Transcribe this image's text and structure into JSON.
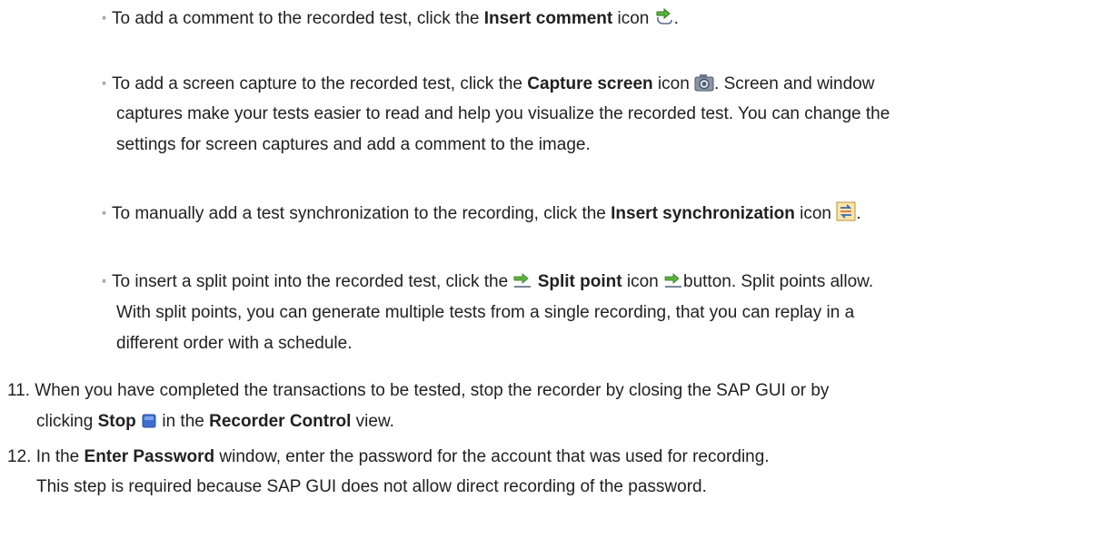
{
  "bullets": {
    "marker": "◦",
    "b1": {
      "pre": "To add a comment to the recorded test, click the ",
      "bold": "Insert comment",
      "post": " icon",
      "end": ".",
      "icon": "insert-comment-icon"
    },
    "b2": {
      "pre": "To add a screen capture to the recorded test, click the ",
      "bold": "Capture screen",
      "post": " icon",
      "after_icon": ". Screen and window",
      "line2": "captures make your tests easier to read and help you visualize the recorded test. You can change the",
      "line3": "settings for screen captures and add a comment to the image.",
      "icon": "camera-icon"
    },
    "b3": {
      "pre": "To manually add a test synchronization to the recording, click the ",
      "bold": "Insert synchronization",
      "post": " icon",
      "end": ".",
      "icon": "synchronization-icon"
    },
    "b4": {
      "pre": "To insert a split point into the recorded test, click the",
      "bold": "Split point",
      "post": " icon",
      "after_icon": "button. Split points allow.",
      "line2": "With split points, you can generate multiple tests from a single recording, that you can replay in a",
      "line3": "different order with a schedule.",
      "icon": "split-point-icon"
    }
  },
  "steps": {
    "s11": {
      "num": "11.",
      "line1": "When you have completed the transactions to be tested, stop the recorder by closing the SAP GUI or by",
      "pre2": "clicking ",
      "bold2": "Stop",
      "mid2": " in the ",
      "bold3": "Recorder Control",
      "post2": " view.",
      "icon": "stop-icon"
    },
    "s12": {
      "num": "12.",
      "pre": "In the ",
      "bold": "Enter Password",
      "post": " window, enter the password for the account that was used for recording.",
      "line2": "This step is required because SAP GUI does not allow direct recording of the password."
    }
  },
  "colors": {
    "text": "#212121",
    "stop_icon": "#3d6fd1",
    "split_arrow": "#4cae3a"
  }
}
